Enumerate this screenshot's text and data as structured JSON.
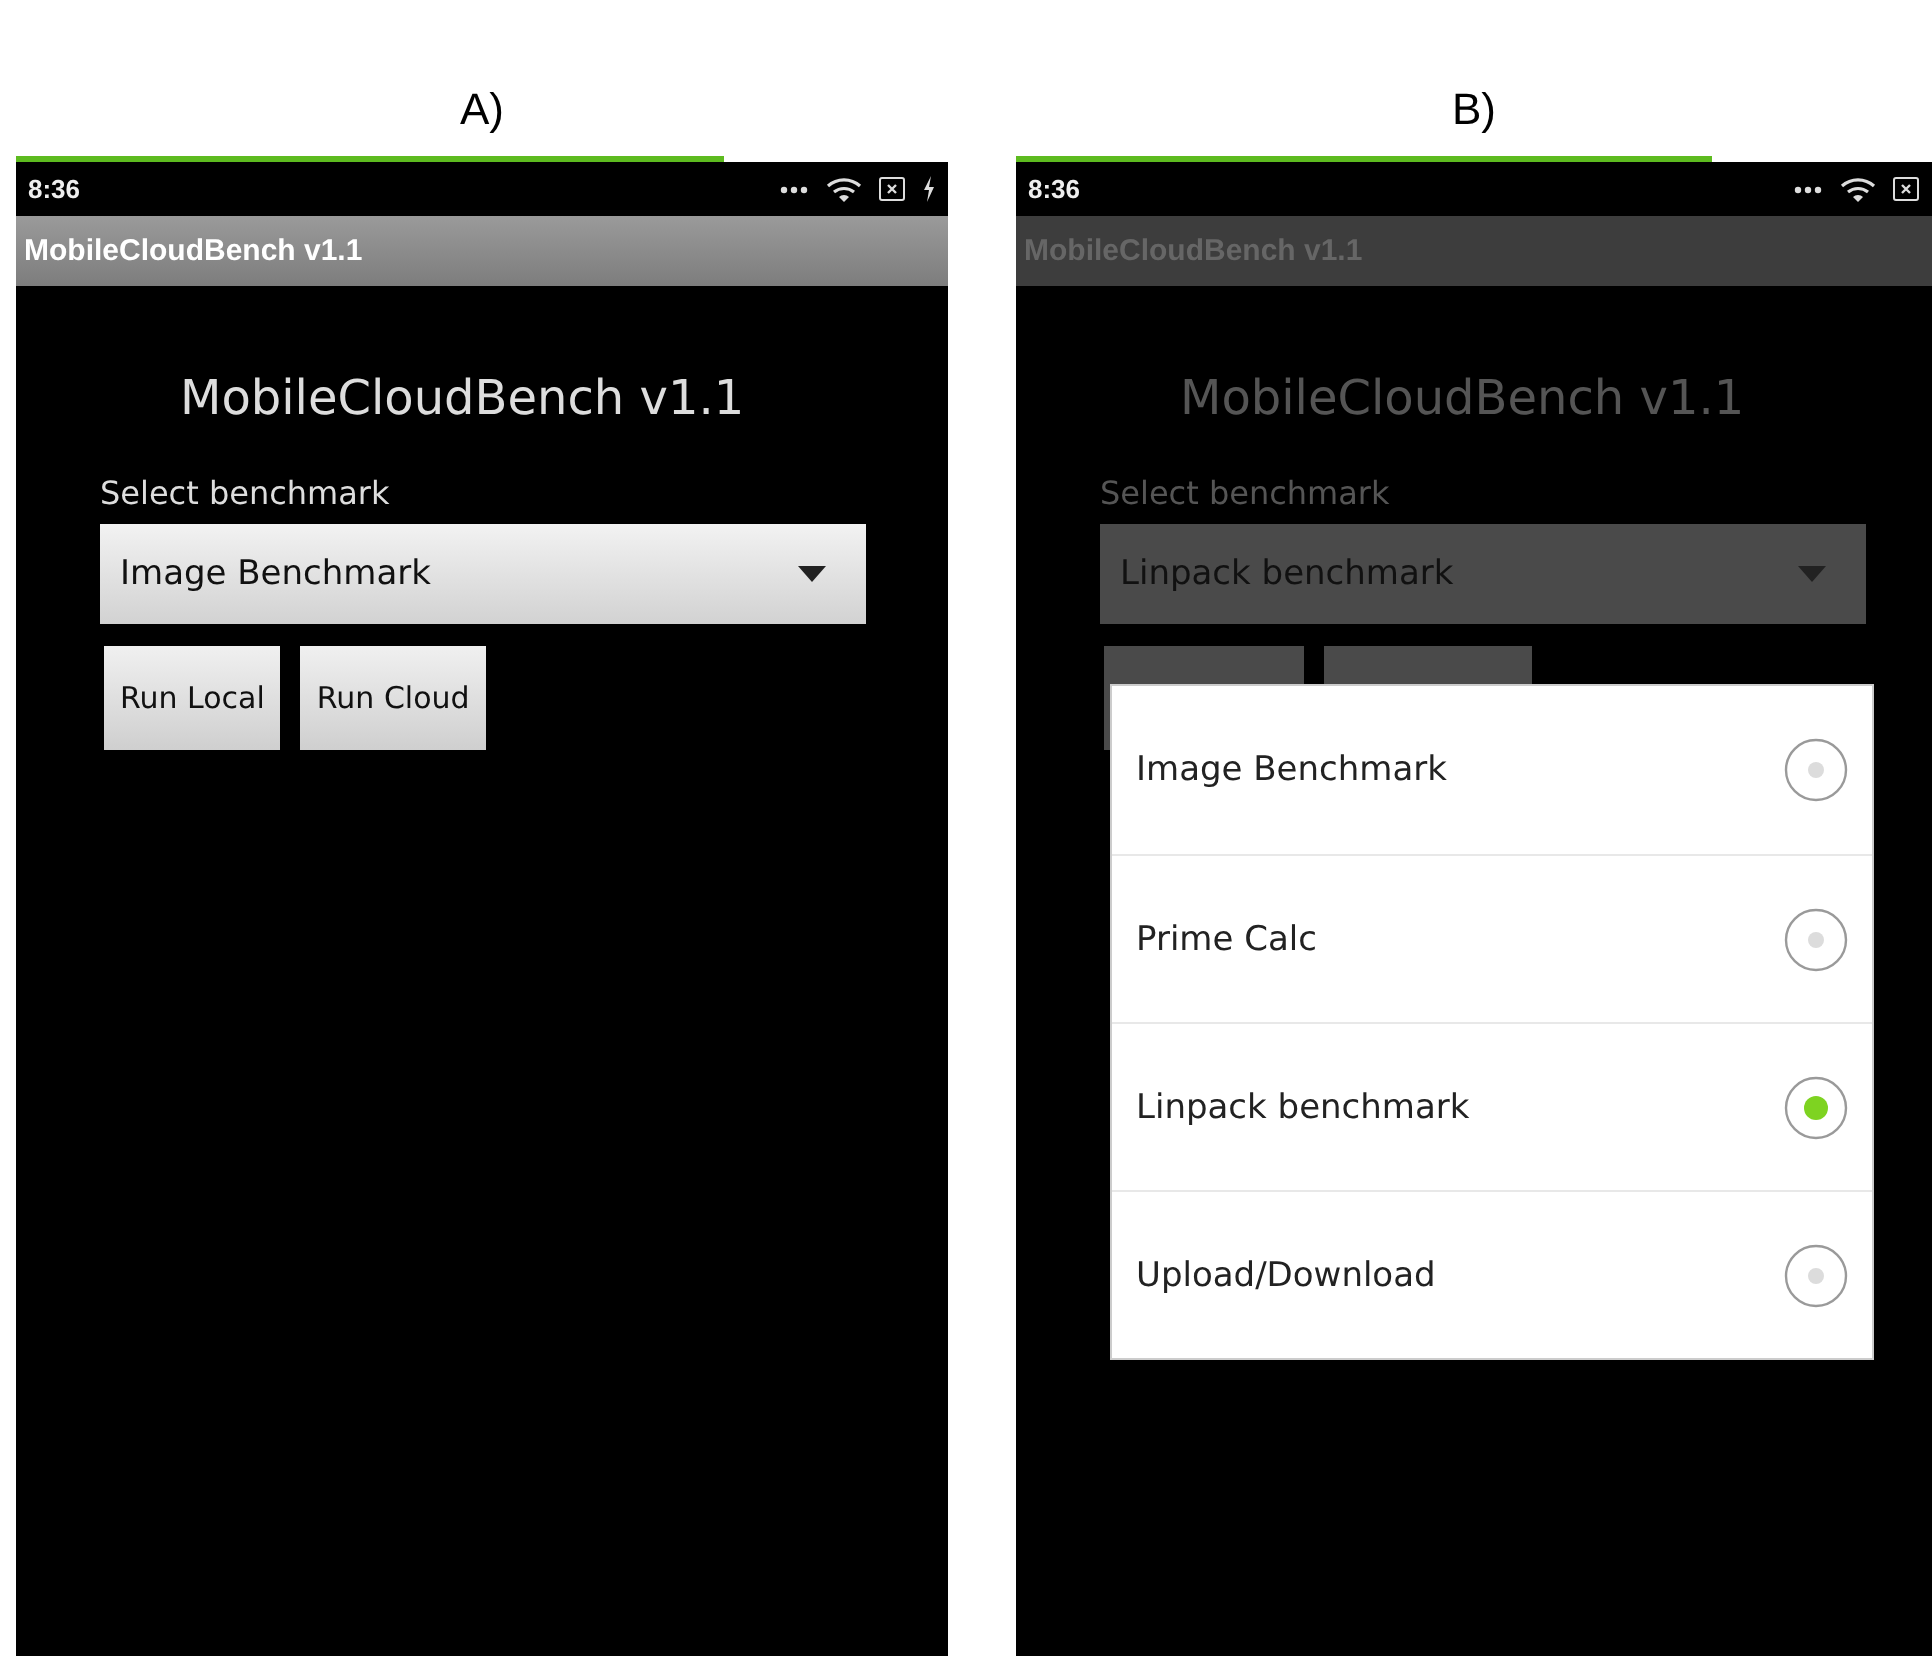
{
  "panels": [
    {
      "label": "A)",
      "dimmed": false,
      "status_bar": {
        "loading": {
          "level": 0.76
        },
        "time": "8:36",
        "charging": true
      },
      "app_bar": {
        "title": "MobileCloudBench v1.1"
      },
      "heading": "MobileCloudBench v1.1",
      "field_label": "Select benchmark",
      "spinner": {
        "value": "Image Benchmark"
      },
      "buttons": [
        "Run Local",
        "Run Cloud"
      ]
    },
    {
      "label": "B)",
      "dimmed": true,
      "status_bar": {
        "loading": {
          "level": 0.76
        },
        "time": "8:36",
        "charging": false
      },
      "app_bar": {
        "title": "MobileCloudBench v1.1"
      },
      "heading": "MobileCloudBench v1.1",
      "field_label": "Select benchmark",
      "spinner": {
        "value": "Linpack benchmark"
      },
      "dialog": {
        "options": [
          {
            "label": "Image Benchmark",
            "selected": false
          },
          {
            "label": "Prime Calc",
            "selected": false
          },
          {
            "label": "Linpack benchmark",
            "selected": true
          },
          {
            "label": "Upload/Download",
            "selected": false
          }
        ]
      }
    }
  ]
}
